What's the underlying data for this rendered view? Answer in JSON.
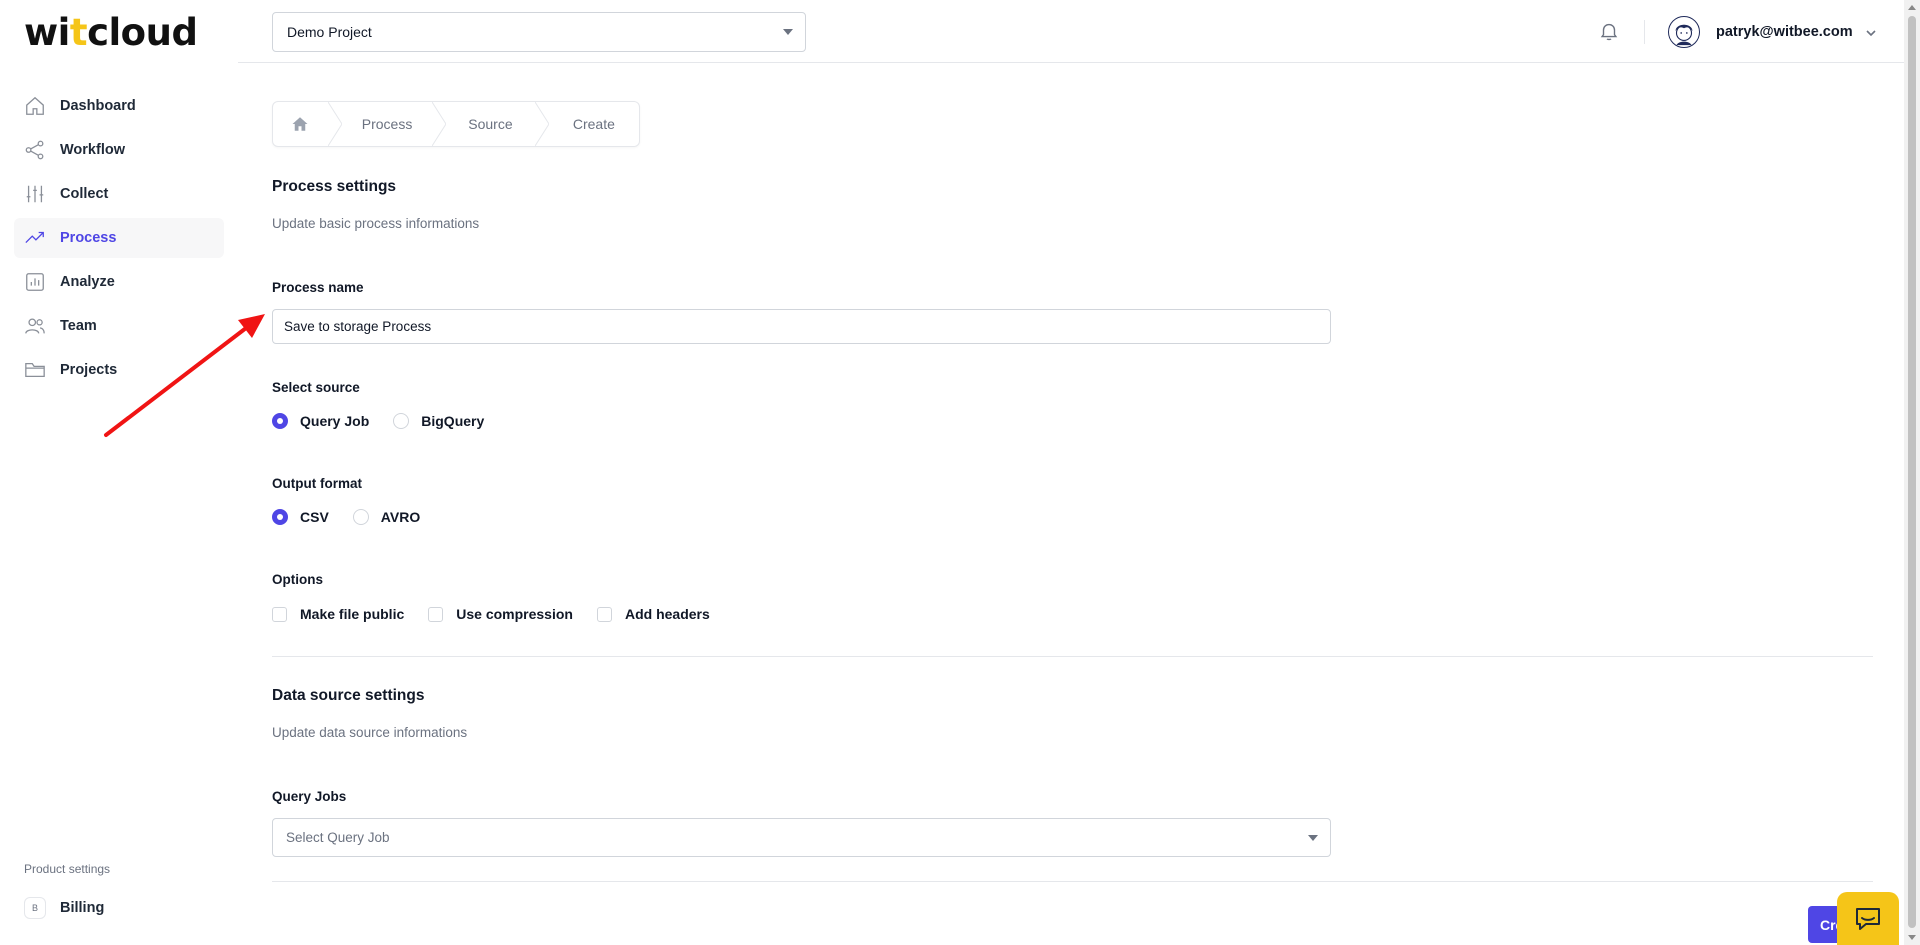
{
  "logo": {
    "pre": "wi",
    "accent": "t",
    "post": "cloud"
  },
  "sidebar": {
    "items": [
      {
        "label": "Dashboard",
        "icon": "home-icon"
      },
      {
        "label": "Workflow",
        "icon": "share-icon"
      },
      {
        "label": "Collect",
        "icon": "sliders-icon"
      },
      {
        "label": "Process",
        "icon": "trend-icon",
        "active": true
      },
      {
        "label": "Analyze",
        "icon": "bar-chart-icon"
      },
      {
        "label": "Team",
        "icon": "users-icon"
      },
      {
        "label": "Projects",
        "icon": "folder-icon"
      }
    ],
    "product_settings_label": "Product settings",
    "billing": {
      "badge": "B",
      "label": "Billing"
    }
  },
  "topbar": {
    "project_select": "Demo Project",
    "user_email": "patryk@witbee.com"
  },
  "breadcrumb": {
    "items": [
      "Process",
      "Source",
      "Create"
    ]
  },
  "process_settings": {
    "title": "Process settings",
    "subtitle": "Update basic process informations",
    "name_label": "Process name",
    "name_value": "Save to storage Process",
    "source_label": "Select source",
    "source_options": [
      "Query Job",
      "BigQuery"
    ],
    "source_selected": "Query Job",
    "format_label": "Output format",
    "format_options": [
      "CSV",
      "AVRO"
    ],
    "format_selected": "CSV",
    "options_label": "Options",
    "options": [
      "Make file public",
      "Use compression",
      "Add headers"
    ]
  },
  "data_source_settings": {
    "title": "Data source settings",
    "subtitle": "Update data source informations",
    "query_jobs_label": "Query Jobs",
    "query_jobs_placeholder": "Select Query Job"
  },
  "actions": {
    "create_label": "Create"
  },
  "colors": {
    "accent": "#4f46e5",
    "brand_yellow": "#f5c518",
    "annotation_arrow": "#f01414"
  }
}
